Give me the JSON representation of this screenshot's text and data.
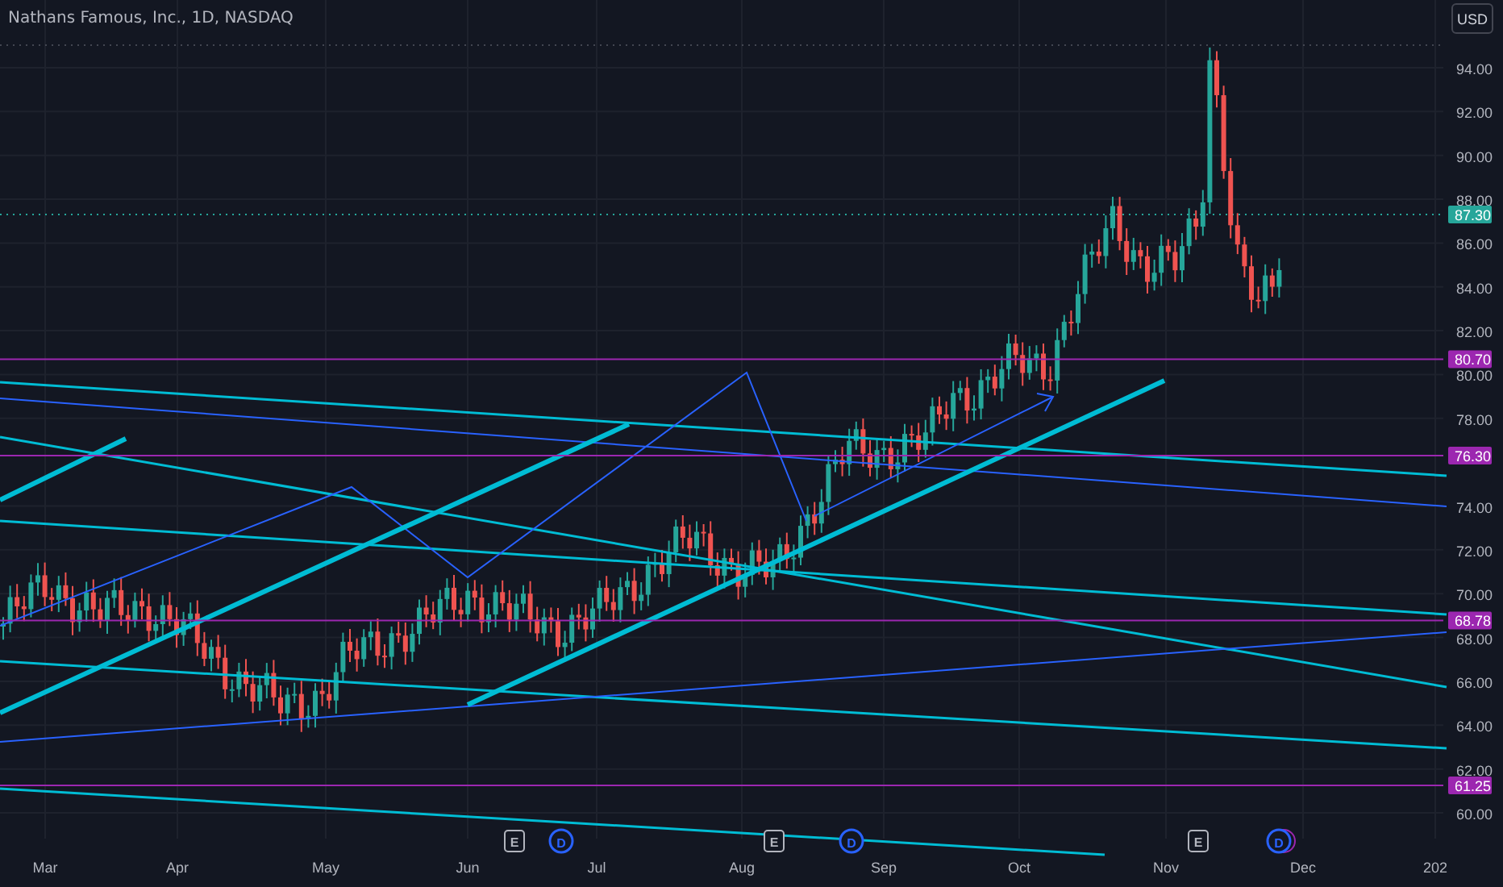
{
  "title": "Nathans Famous, Inc., 1D, NASDAQ",
  "currency_button": "USD",
  "price_axis": [
    "94.00",
    "92.00",
    "90.00",
    "88.00",
    "86.00",
    "84.00",
    "82.00",
    "80.00",
    "78.00",
    "74.00",
    "72.00",
    "70.00",
    "68.00",
    "66.00",
    "64.00",
    "62.00",
    "60.00"
  ],
  "price_tags": [
    {
      "label": "87.30",
      "color": "#26a69a",
      "kind": "last"
    },
    {
      "label": "80.70",
      "color": "#9c27b0",
      "kind": "level"
    },
    {
      "label": "76.30",
      "color": "#9c27b0",
      "kind": "level"
    },
    {
      "label": "68.78",
      "color": "#9c27b0",
      "kind": "level"
    },
    {
      "label": "61.25",
      "color": "#9c27b0",
      "kind": "level"
    }
  ],
  "time_axis": [
    "Mar",
    "Apr",
    "May",
    "Jun",
    "Jul",
    "Aug",
    "Sep",
    "Oct",
    "Nov",
    "Dec",
    "202"
  ],
  "events": [
    {
      "letter": "E",
      "kind": "earnings"
    },
    {
      "letter": "D",
      "kind": "dividend"
    },
    {
      "letter": "E",
      "kind": "earnings"
    },
    {
      "letter": "D",
      "kind": "dividend"
    },
    {
      "letter": "E",
      "kind": "earnings"
    },
    {
      "letter": "D",
      "kind": "dividend-multi"
    }
  ]
}
